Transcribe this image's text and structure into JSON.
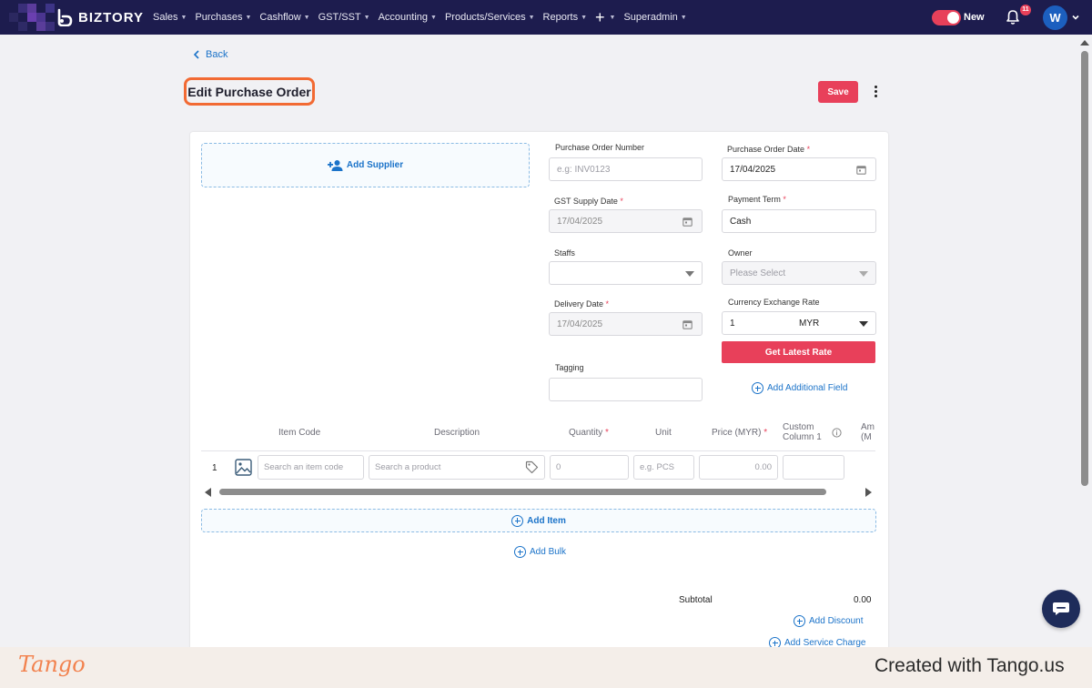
{
  "app": {
    "brand": "BIZTORY"
  },
  "nav": {
    "items": [
      "Sales",
      "Purchases",
      "Cashflow",
      "GST/SST",
      "Accounting",
      "Products/Services",
      "Reports"
    ],
    "superadmin": "Superadmin",
    "toggle_label": "New",
    "notification_count": "11",
    "avatar_initial": "W"
  },
  "header": {
    "back_label": "Back",
    "title": "Edit Purchase Order",
    "save_label": "Save"
  },
  "form": {
    "add_supplier": "Add Supplier",
    "po_number": {
      "label": "Purchase Order Number",
      "placeholder": "e.g: INV0123",
      "value": ""
    },
    "po_date": {
      "label": "Purchase Order Date",
      "value": "17/04/2025"
    },
    "gst_supply_date": {
      "label": "GST Supply Date",
      "value": "17/04/2025"
    },
    "payment_term": {
      "label": "Payment Term",
      "value": "Cash"
    },
    "staffs": {
      "label": "Staffs",
      "value": ""
    },
    "owner": {
      "label": "Owner",
      "placeholder": "Please Select"
    },
    "delivery_date": {
      "label": "Delivery Date",
      "value": "17/04/2025"
    },
    "currency": {
      "label": "Currency Exchange Rate",
      "rate": "1",
      "currency": "MYR"
    },
    "get_rate_label": "Get Latest Rate",
    "tagging": {
      "label": "Tagging",
      "value": ""
    },
    "add_additional_field": "Add Additional Field"
  },
  "items_table": {
    "headers": {
      "item_code": "Item Code",
      "description": "Description",
      "quantity": "Quantity",
      "unit": "Unit",
      "price": "Price (MYR)",
      "custom_line1": "Custom",
      "custom_line2": "Column 1",
      "amount_line1": "Am",
      "amount_line2": "(M"
    },
    "rows": [
      {
        "number": "1",
        "item_code_placeholder": "Search an item code",
        "description_placeholder": "Search a product",
        "quantity_placeholder": "0",
        "unit_placeholder": "e.g. PCS",
        "price_placeholder": "0.00"
      }
    ],
    "add_item": "Add Item",
    "add_bulk": "Add Bulk"
  },
  "summary": {
    "subtotal_label": "Subtotal",
    "subtotal_value": "0.00",
    "add_discount": "Add Discount",
    "add_service_charge": "Add Service Charge"
  },
  "footer": {
    "logo": "Tango",
    "created_with": "Created with Tango.us"
  },
  "colors": {
    "navbar": "#1d1c4e",
    "accent": "#e8405a",
    "link": "#1b73c9",
    "highlight": "#f26a33"
  }
}
